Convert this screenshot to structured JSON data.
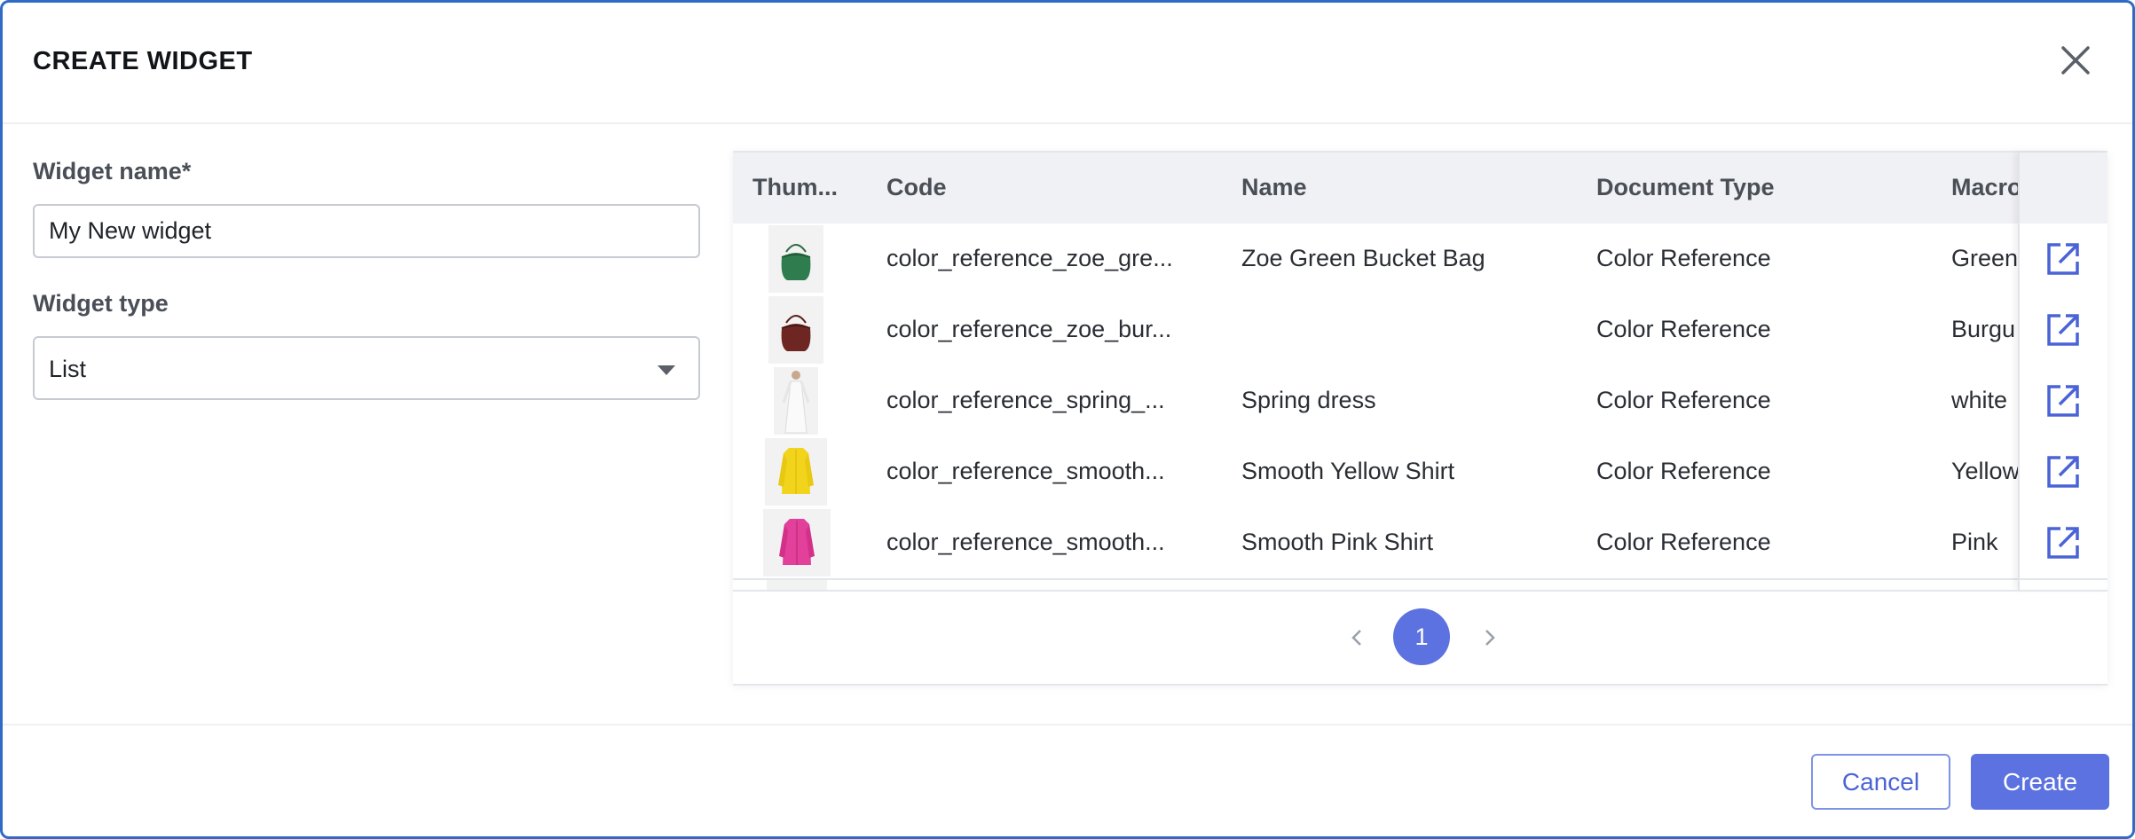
{
  "dialog": {
    "title": "CREATE WIDGET"
  },
  "form": {
    "name_label": "Widget name*",
    "name_value": "My New widget",
    "type_label": "Widget type",
    "type_value": "List"
  },
  "table": {
    "columns": [
      "Thum...",
      "Code",
      "Name",
      "Document Type",
      "Macro"
    ],
    "rows": [
      {
        "thumbnail": "green-bucket-bag",
        "code": "color_reference_zoe_gre...",
        "name": "Zoe Green Bucket Bag",
        "document_type": "Color Reference",
        "macro": "Green"
      },
      {
        "thumbnail": "burgundy-bucket-bag",
        "code": "color_reference_zoe_bur...",
        "name": "",
        "document_type": "Color Reference",
        "macro": "Burgu"
      },
      {
        "thumbnail": "white-dress",
        "code": "color_reference_spring_...",
        "name": "Spring dress",
        "document_type": "Color Reference",
        "macro": "white"
      },
      {
        "thumbnail": "yellow-shirt",
        "code": "color_reference_smooth...",
        "name": "Smooth Yellow Shirt",
        "document_type": "Color Reference",
        "macro": "Yellow"
      },
      {
        "thumbnail": "pink-shirt",
        "code": "color_reference_smooth...",
        "name": "Smooth Pink Shirt",
        "document_type": "Color Reference",
        "macro": "Pink"
      }
    ],
    "open_icon": "external-link-icon"
  },
  "pagination": {
    "current_page": "1"
  },
  "footer": {
    "cancel_label": "Cancel",
    "create_label": "Create"
  },
  "colors": {
    "accent": "#5b72e0",
    "border": "#2f6bc4"
  }
}
